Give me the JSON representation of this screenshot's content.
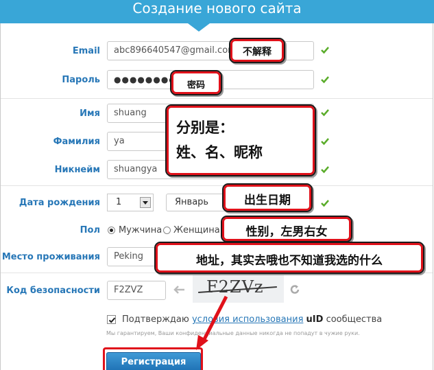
{
  "page_title": "Создание нового сайта",
  "fields": {
    "email": {
      "label": "Email",
      "value": "abc896640547@gmail.com"
    },
    "password": {
      "label": "Пароль",
      "value": "●●●●●●●●●"
    },
    "first_name": {
      "label": "Имя",
      "value": "shuang"
    },
    "last_name": {
      "label": "Фамилия",
      "value": "ya"
    },
    "nickname": {
      "label": "Никнейм",
      "value": "shuangya"
    },
    "birthdate": {
      "label": "Дата рождения",
      "day": "1",
      "month": "Январь"
    },
    "gender": {
      "label": "Пол",
      "male": "Мужчина",
      "female": "Женщина",
      "selected": "male"
    },
    "location": {
      "label": "Место проживания",
      "value": "Peking"
    },
    "captcha": {
      "label": "Код безопасности",
      "value": "F2ZVZ",
      "image_text": "F2ZVz"
    }
  },
  "terms": {
    "prefix": "Подтверждаю",
    "link": "условия использования",
    "suffix_uid": "uID",
    "suffix": "сообщества",
    "note": "Мы гарантируем, Ваши конфиденциальные данные никогда не попадут в чужие руки.",
    "checked": true
  },
  "submit_label": "Регистрация",
  "annotations": {
    "email": "不解释",
    "password": "密码",
    "names_line1": "分别是：",
    "names_line2": "姓、名、昵称",
    "birthdate": "出生日期",
    "gender": "性别，左男右女",
    "location": "地址，其实去哦也不知道我选的什么"
  },
  "colors": {
    "header": "#39a6d7",
    "label": "#2777b7",
    "check": "#5aac2a",
    "annotation_border": "#e0111a",
    "button": "#1d6fb3"
  }
}
